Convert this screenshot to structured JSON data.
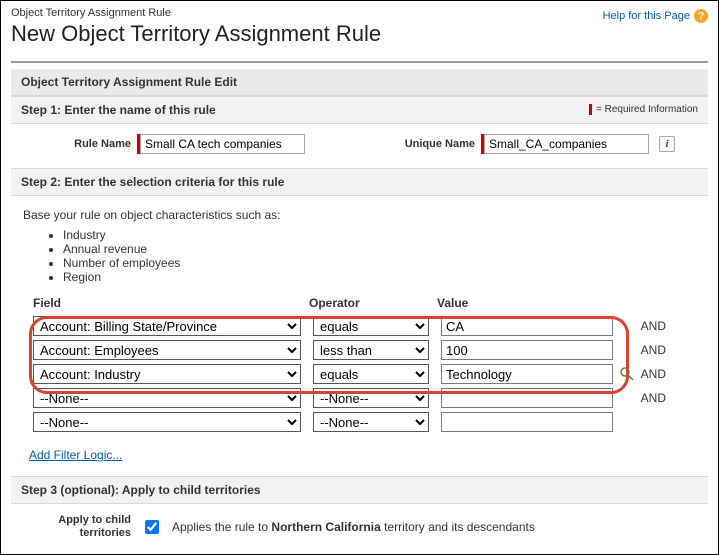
{
  "breadcrumb": "Object Territory Assignment Rule",
  "page_title": "New Object Territory Assignment Rule",
  "help_link": "Help for this Page",
  "edit_header": "Object Territory Assignment Rule Edit",
  "step1": {
    "title": "Step 1: Enter the name of this rule",
    "required_info": "= Required Information",
    "rule_name_label": "Rule Name",
    "rule_name_value": "Small CA tech companies",
    "unique_name_label": "Unique Name",
    "unique_name_value": "Small_CA_companies"
  },
  "step2": {
    "title": "Step 2: Enter the selection criteria for this rule",
    "intro": "Base your rule on object characteristics such as:",
    "chars": [
      "Industry",
      "Annual revenue",
      "Number of employees",
      "Region"
    ],
    "cols": {
      "field": "Field",
      "operator": "Operator",
      "value": "Value"
    },
    "rows": [
      {
        "field": "Account: Billing State/Province",
        "operator": "equals",
        "value": "CA",
        "logic": "AND",
        "lookup": false
      },
      {
        "field": "Account: Employees",
        "operator": "less than",
        "value": "100",
        "logic": "AND",
        "lookup": false
      },
      {
        "field": "Account: Industry",
        "operator": "equals",
        "value": "Technology",
        "logic": "AND",
        "lookup": true
      },
      {
        "field": "--None--",
        "operator": "--None--",
        "value": "",
        "logic": "AND",
        "lookup": false
      },
      {
        "field": "--None--",
        "operator": "--None--",
        "value": "",
        "logic": "",
        "lookup": false
      }
    ],
    "add_filter": "Add Filter Logic..."
  },
  "step3": {
    "title": "Step 3 (optional): Apply to child territories",
    "label": "Apply to child territories",
    "checked": true,
    "text_prefix": "Applies the rule to ",
    "territory": "Northern California",
    "text_suffix": " territory and its descendants"
  }
}
